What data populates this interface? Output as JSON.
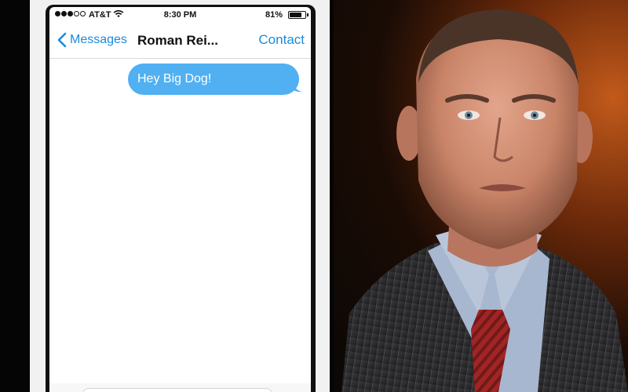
{
  "status_bar": {
    "carrier": "AT&T",
    "time": "8:30 PM",
    "battery_percent": "81%",
    "battery_level": 0.81,
    "signal_bars": 3,
    "signal_total": 5
  },
  "nav": {
    "back_label": "Messages",
    "title": "Roman Rei...",
    "contact_label": "Contact"
  },
  "messages": [
    {
      "text": "Hey Big Dog!",
      "direction": "outgoing"
    }
  ],
  "colors": {
    "accent": "#1a8bdd",
    "bubble": "#50b0f2"
  },
  "photo": {
    "subject": "man in pinstripe suit with red striped tie"
  }
}
